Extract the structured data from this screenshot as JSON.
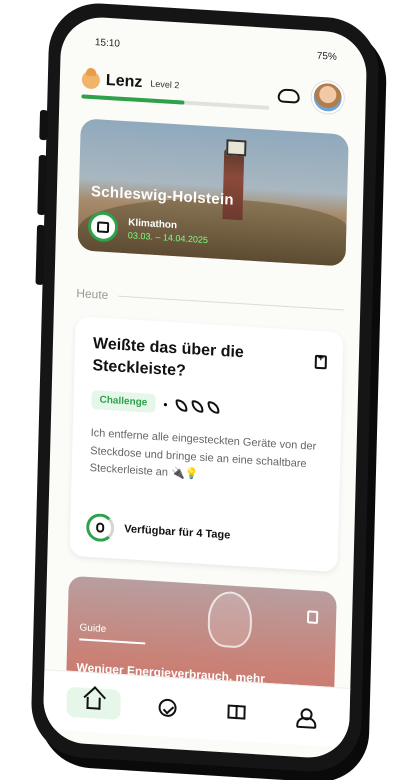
{
  "status": {
    "time": "15:10",
    "battery": "75%"
  },
  "header": {
    "app_name": "Lenz",
    "level": "Level 2",
    "progress_fraction": 0.55
  },
  "hero": {
    "title": "Schleswig-Holstein",
    "event_name": "Klimathon",
    "event_dates": "03.03. – 14.04.2025"
  },
  "section": {
    "label": "Heute"
  },
  "challenge_card": {
    "title": "Weißte das über die Steckleiste?",
    "badge": "Challenge",
    "separator": "•",
    "description": "Ich entferne alle eingesteckten Geräte von der Steckdose und bringe sie an eine schaltbare Steckerleiste an 🔌💡",
    "availability": "Verfügbar für 4 Tage"
  },
  "guide_card": {
    "label": "Guide",
    "title": "Weniger Energieverbrauch, mehr Klimaschutz 🔋"
  },
  "nav": {
    "items": [
      {
        "icon": "home-icon",
        "active": true
      },
      {
        "icon": "check-circle-icon",
        "active": false
      },
      {
        "icon": "gift-icon",
        "active": false
      },
      {
        "icon": "users-icon",
        "active": false
      }
    ]
  },
  "colors": {
    "accent": "#2da24b",
    "accent_soft": "#e6f7ea",
    "date_green": "#7cff7c"
  }
}
